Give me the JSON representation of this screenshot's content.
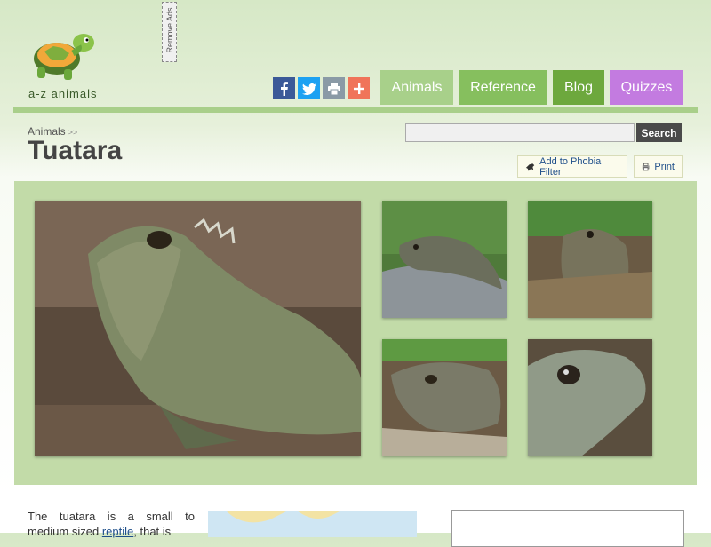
{
  "header": {
    "logo_text": "a-z animals",
    "remove_ads": "Remove Ads"
  },
  "share": [
    {
      "icon": "facebook-icon",
      "color": "#3b5998"
    },
    {
      "icon": "twitter-icon",
      "color": "#1da1f2"
    },
    {
      "icon": "print-icon",
      "color": "#8a9aa6"
    },
    {
      "icon": "plus-icon",
      "color": "#f0745a"
    }
  ],
  "nav": {
    "animals": "Animals",
    "reference": "Reference",
    "blog": "Blog",
    "quizzes": "Quizzes",
    "colors": {
      "animals": "#a8d08a",
      "reference": "#86bf5e",
      "blog": "#6da83d",
      "quizzes": "#c37be0"
    }
  },
  "breadcrumb": {
    "item": "Animals",
    "separator": ">>"
  },
  "page_title": "Tuatara",
  "search": {
    "placeholder": "",
    "button": "Search"
  },
  "tools": {
    "phobia": "Add to Phobia Filter",
    "print": "Print"
  },
  "gallery": {
    "photos": [
      {
        "name": "tuatara-main-photo"
      },
      {
        "name": "tuatara-photo-2"
      },
      {
        "name": "tuatara-photo-3"
      },
      {
        "name": "tuatara-photo-4"
      },
      {
        "name": "tuatara-photo-5"
      }
    ]
  },
  "article": {
    "intro_before_link": "The tuatara is a small to medium sized",
    "intro_link": "reptile",
    "intro_after_link": ", that is"
  }
}
